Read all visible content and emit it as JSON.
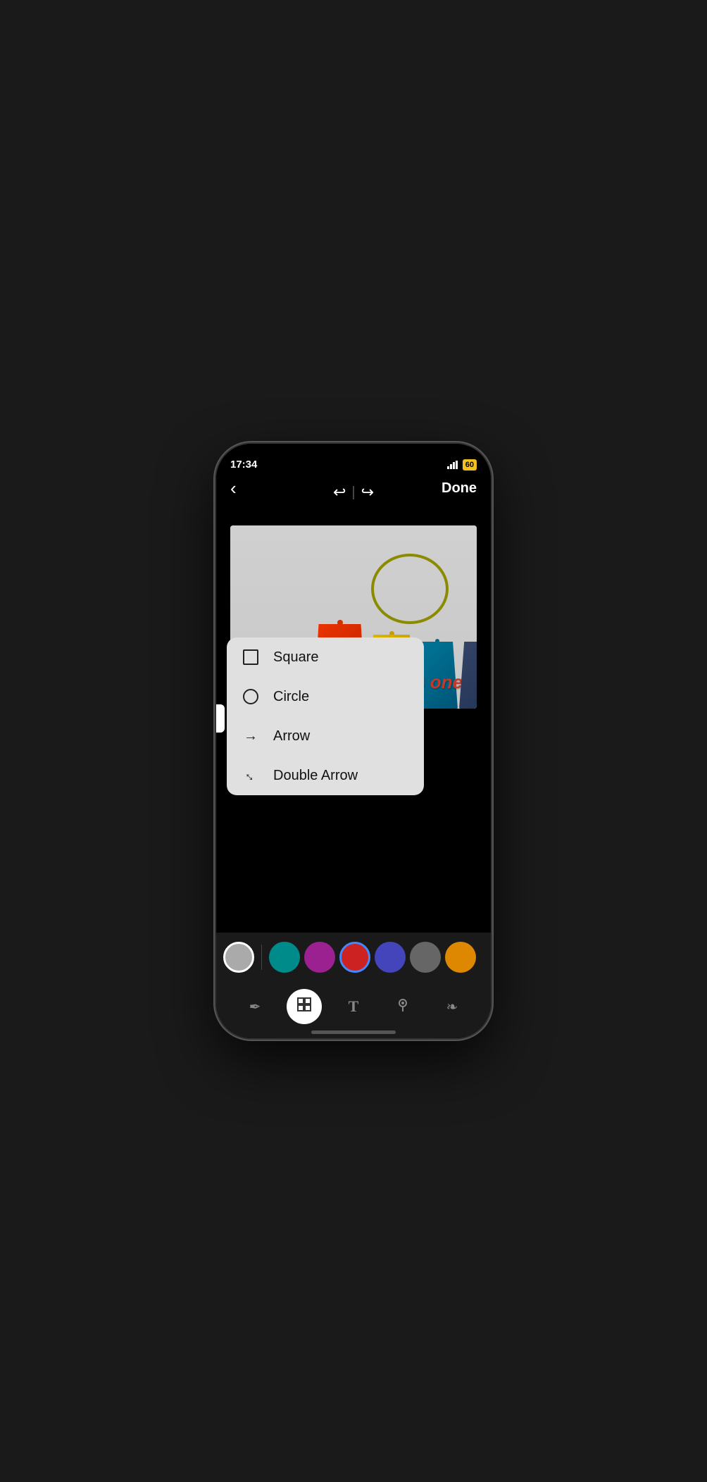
{
  "statusBar": {
    "time": "17:34",
    "batteryLabel": "60"
  },
  "toolbar": {
    "backLabel": "‹",
    "undoLabel": "↩",
    "redoLabel": "↪",
    "doneLabel": "Done"
  },
  "annotation": {
    "thisOneText": "This one"
  },
  "shapeMenu": {
    "items": [
      {
        "id": "square",
        "label": "Square",
        "iconType": "square"
      },
      {
        "id": "circle",
        "label": "Circle",
        "iconType": "circle"
      },
      {
        "id": "arrow",
        "label": "Arrow",
        "iconType": "arrow"
      },
      {
        "id": "double-arrow",
        "label": "Double Arrow",
        "iconType": "double-arrow"
      }
    ]
  },
  "colorPalette": {
    "colors": [
      {
        "id": "gray",
        "hex": "#aaaaaa",
        "selected": true
      },
      {
        "id": "teal",
        "hex": "#008b8b",
        "selected": false
      },
      {
        "id": "purple",
        "hex": "#9b2090",
        "selected": false
      },
      {
        "id": "red",
        "hex": "#cc2222",
        "selected": false
      },
      {
        "id": "blue-purple",
        "hex": "#4444bb",
        "selected": false
      },
      {
        "id": "dark-gray",
        "hex": "#666666",
        "selected": false
      },
      {
        "id": "orange",
        "hex": "#dd8800",
        "selected": false
      }
    ]
  },
  "bottomTools": [
    {
      "id": "pen",
      "icon": "✏",
      "active": false,
      "label": "Pen tool"
    },
    {
      "id": "shapes",
      "icon": "⧉",
      "active": true,
      "label": "Shapes tool"
    },
    {
      "id": "text",
      "icon": "T",
      "active": false,
      "label": "Text tool"
    },
    {
      "id": "location",
      "icon": "◎",
      "active": false,
      "label": "Location tool"
    },
    {
      "id": "filter",
      "icon": "❧",
      "active": false,
      "label": "Filter tool"
    }
  ]
}
